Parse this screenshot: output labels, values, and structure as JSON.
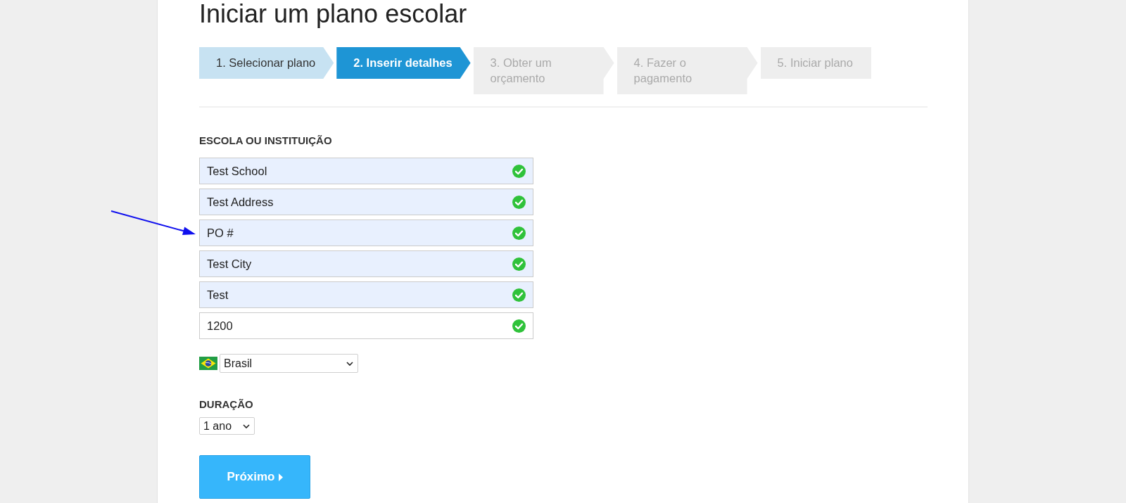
{
  "page": {
    "title": "Iniciar um plano escolar"
  },
  "steps": [
    {
      "label": "1. Selecionar plano",
      "completed": true,
      "current": false
    },
    {
      "label": "2. Inserir detalhes",
      "completed": false,
      "current": true
    },
    {
      "label": "3. Obter um orçamento",
      "completed": false,
      "current": false
    },
    {
      "label": "4. Fazer o pagamento",
      "completed": false,
      "current": false
    },
    {
      "label": "5. Iniciar plano",
      "completed": false,
      "current": false
    }
  ],
  "school_section": {
    "label": "ESCOLA OU INSTITUIÇÃO",
    "fields": [
      {
        "value": "Test School",
        "autofilled": true,
        "valid": true
      },
      {
        "value": "Test Address",
        "autofilled": true,
        "valid": true
      },
      {
        "value": "PO #",
        "autofilled": true,
        "valid": true
      },
      {
        "value": "Test City",
        "autofilled": true,
        "valid": true
      },
      {
        "value": "Test",
        "autofilled": true,
        "valid": true
      },
      {
        "value": "1200",
        "autofilled": false,
        "valid": true
      }
    ]
  },
  "country": {
    "value": "Brasil"
  },
  "duration": {
    "label": "DURAÇÃO",
    "value": "1 ano"
  },
  "next_button": {
    "label": "Próximo"
  }
}
